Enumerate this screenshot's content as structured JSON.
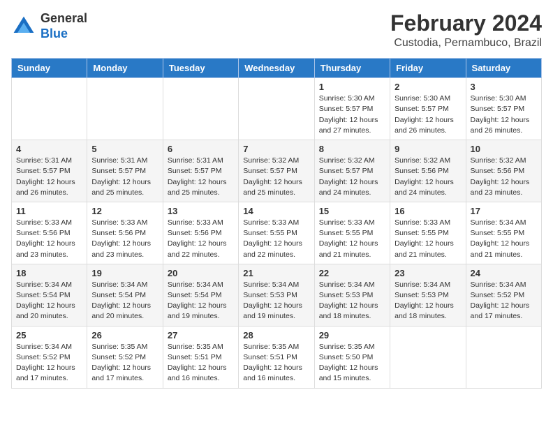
{
  "header": {
    "logo_general": "General",
    "logo_blue": "Blue",
    "month_year": "February 2024",
    "location": "Custodia, Pernambuco, Brazil"
  },
  "weekdays": [
    "Sunday",
    "Monday",
    "Tuesday",
    "Wednesday",
    "Thursday",
    "Friday",
    "Saturday"
  ],
  "weeks": [
    [
      {
        "day": "",
        "info": ""
      },
      {
        "day": "",
        "info": ""
      },
      {
        "day": "",
        "info": ""
      },
      {
        "day": "",
        "info": ""
      },
      {
        "day": "1",
        "info": "Sunrise: 5:30 AM\nSunset: 5:57 PM\nDaylight: 12 hours\nand 27 minutes."
      },
      {
        "day": "2",
        "info": "Sunrise: 5:30 AM\nSunset: 5:57 PM\nDaylight: 12 hours\nand 26 minutes."
      },
      {
        "day": "3",
        "info": "Sunrise: 5:30 AM\nSunset: 5:57 PM\nDaylight: 12 hours\nand 26 minutes."
      }
    ],
    [
      {
        "day": "4",
        "info": "Sunrise: 5:31 AM\nSunset: 5:57 PM\nDaylight: 12 hours\nand 26 minutes."
      },
      {
        "day": "5",
        "info": "Sunrise: 5:31 AM\nSunset: 5:57 PM\nDaylight: 12 hours\nand 25 minutes."
      },
      {
        "day": "6",
        "info": "Sunrise: 5:31 AM\nSunset: 5:57 PM\nDaylight: 12 hours\nand 25 minutes."
      },
      {
        "day": "7",
        "info": "Sunrise: 5:32 AM\nSunset: 5:57 PM\nDaylight: 12 hours\nand 25 minutes."
      },
      {
        "day": "8",
        "info": "Sunrise: 5:32 AM\nSunset: 5:57 PM\nDaylight: 12 hours\nand 24 minutes."
      },
      {
        "day": "9",
        "info": "Sunrise: 5:32 AM\nSunset: 5:56 PM\nDaylight: 12 hours\nand 24 minutes."
      },
      {
        "day": "10",
        "info": "Sunrise: 5:32 AM\nSunset: 5:56 PM\nDaylight: 12 hours\nand 23 minutes."
      }
    ],
    [
      {
        "day": "11",
        "info": "Sunrise: 5:33 AM\nSunset: 5:56 PM\nDaylight: 12 hours\nand 23 minutes."
      },
      {
        "day": "12",
        "info": "Sunrise: 5:33 AM\nSunset: 5:56 PM\nDaylight: 12 hours\nand 23 minutes."
      },
      {
        "day": "13",
        "info": "Sunrise: 5:33 AM\nSunset: 5:56 PM\nDaylight: 12 hours\nand 22 minutes."
      },
      {
        "day": "14",
        "info": "Sunrise: 5:33 AM\nSunset: 5:55 PM\nDaylight: 12 hours\nand 22 minutes."
      },
      {
        "day": "15",
        "info": "Sunrise: 5:33 AM\nSunset: 5:55 PM\nDaylight: 12 hours\nand 21 minutes."
      },
      {
        "day": "16",
        "info": "Sunrise: 5:33 AM\nSunset: 5:55 PM\nDaylight: 12 hours\nand 21 minutes."
      },
      {
        "day": "17",
        "info": "Sunrise: 5:34 AM\nSunset: 5:55 PM\nDaylight: 12 hours\nand 21 minutes."
      }
    ],
    [
      {
        "day": "18",
        "info": "Sunrise: 5:34 AM\nSunset: 5:54 PM\nDaylight: 12 hours\nand 20 minutes."
      },
      {
        "day": "19",
        "info": "Sunrise: 5:34 AM\nSunset: 5:54 PM\nDaylight: 12 hours\nand 20 minutes."
      },
      {
        "day": "20",
        "info": "Sunrise: 5:34 AM\nSunset: 5:54 PM\nDaylight: 12 hours\nand 19 minutes."
      },
      {
        "day": "21",
        "info": "Sunrise: 5:34 AM\nSunset: 5:53 PM\nDaylight: 12 hours\nand 19 minutes."
      },
      {
        "day": "22",
        "info": "Sunrise: 5:34 AM\nSunset: 5:53 PM\nDaylight: 12 hours\nand 18 minutes."
      },
      {
        "day": "23",
        "info": "Sunrise: 5:34 AM\nSunset: 5:53 PM\nDaylight: 12 hours\nand 18 minutes."
      },
      {
        "day": "24",
        "info": "Sunrise: 5:34 AM\nSunset: 5:52 PM\nDaylight: 12 hours\nand 17 minutes."
      }
    ],
    [
      {
        "day": "25",
        "info": "Sunrise: 5:34 AM\nSunset: 5:52 PM\nDaylight: 12 hours\nand 17 minutes."
      },
      {
        "day": "26",
        "info": "Sunrise: 5:35 AM\nSunset: 5:52 PM\nDaylight: 12 hours\nand 17 minutes."
      },
      {
        "day": "27",
        "info": "Sunrise: 5:35 AM\nSunset: 5:51 PM\nDaylight: 12 hours\nand 16 minutes."
      },
      {
        "day": "28",
        "info": "Sunrise: 5:35 AM\nSunset: 5:51 PM\nDaylight: 12 hours\nand 16 minutes."
      },
      {
        "day": "29",
        "info": "Sunrise: 5:35 AM\nSunset: 5:50 PM\nDaylight: 12 hours\nand 15 minutes."
      },
      {
        "day": "",
        "info": ""
      },
      {
        "day": "",
        "info": ""
      }
    ]
  ]
}
